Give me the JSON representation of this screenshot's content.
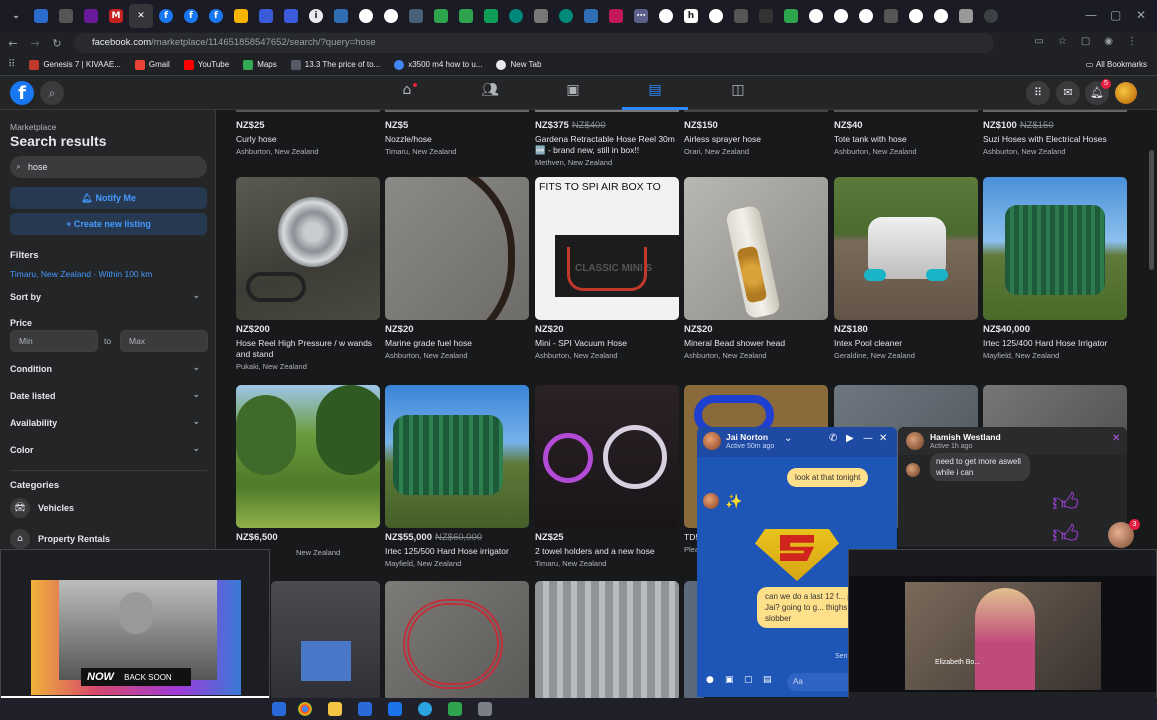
{
  "browser": {
    "url_domain": "facebook.com",
    "url_path": "/marketplace/114651858547652/search/?query=hose",
    "bookmarks": [
      {
        "label": "Genesis 7 | KIVAAE...",
        "color": "#c0392b"
      },
      {
        "label": "Gmail",
        "color": "#ea4335"
      },
      {
        "label": "YouTube",
        "color": "#ff0000"
      },
      {
        "label": "Maps",
        "color": "#34a853"
      },
      {
        "label": "13.3 The price of to...",
        "color": "#555a64"
      },
      {
        "label": "x3500 m4 how to u...",
        "color": "#4285f4"
      },
      {
        "label": "New Tab",
        "color": "#e8eaed"
      }
    ],
    "all_bookmarks": "All Bookmarks"
  },
  "sidebar": {
    "breadcrumb": "Marketplace",
    "title": "Search results",
    "search_value": "hose",
    "notify_button": "Notify Me",
    "create_button": "Create new listing",
    "filters_heading": "Filters",
    "location": "Timaru, New Zealand · Within 100 km",
    "sort_by": "Sort by",
    "price_label": "Price",
    "price_min_placeholder": "Min",
    "price_to": "to",
    "price_max_placeholder": "Max",
    "condition": "Condition",
    "date_listed": "Date listed",
    "availability": "Availability",
    "color": "Color",
    "categories_heading": "Categories",
    "categories": [
      "Vehicles",
      "Property Rentals"
    ]
  },
  "listings_row0": [
    {
      "price": "NZ$25",
      "old_price": "",
      "title": "Curly hose",
      "location": "Ashburton, New Zealand"
    },
    {
      "price": "NZ$5",
      "old_price": "",
      "title": "Nozzle/hose",
      "location": "Timaru, New Zealand"
    },
    {
      "price": "NZ$375",
      "old_price": "NZ$400",
      "title": "Gardena Retractable Hose Reel 30m 🆕 - brand new, still in box!!",
      "location": "Methven, New Zealand"
    },
    {
      "price": "NZ$150",
      "old_price": "",
      "title": "Airless sprayer hose",
      "location": "Orari, New Zealand"
    },
    {
      "price": "NZ$40",
      "old_price": "",
      "title": "Tote tank with hose",
      "location": "Ashburton, New Zealand"
    },
    {
      "price": "NZ$100",
      "old_price": "NZ$150",
      "title": "Suzi Hoses with Electrical Hoses",
      "location": "Ashburton, New Zealand"
    }
  ],
  "listings_row1": [
    {
      "price": "NZ$200",
      "old_price": "",
      "title": "Hose Reel High Pressure / w wands and stand",
      "location": "Pukaki, New Zealand"
    },
    {
      "price": "NZ$20",
      "old_price": "",
      "title": "Marine grade fuel hose",
      "location": "Ashburton, New Zealand"
    },
    {
      "price": "NZ$20",
      "old_price": "",
      "title": "Mini - SPI Vacuum Hose",
      "location": "Ashburton, New Zealand"
    },
    {
      "price": "NZ$20",
      "old_price": "",
      "title": "Mineral Bead shower head",
      "location": "Ashburton, New Zealand"
    },
    {
      "price": "NZ$180",
      "old_price": "",
      "title": "Intex Pool cleaner",
      "location": "Geraldine, New Zealand"
    },
    {
      "price": "NZ$40,000",
      "old_price": "",
      "title": "Irtec 125/400 Hard Hose Irrigator",
      "location": "Mayfield, New Zealand"
    }
  ],
  "listings_row2": [
    {
      "price": "NZ$6,500",
      "old_price": "",
      "title": "",
      "location": "New Zealand"
    },
    {
      "price": "NZ$55,000",
      "old_price": "NZ$60,000",
      "title": "Irtec 125/500 Hard Hose irrigator",
      "location": "Mayfield, New Zealand"
    },
    {
      "price": "NZ$25",
      "old_price": "",
      "title": "2 towel holders and a new hose",
      "location": "Timaru, New Zealand"
    },
    {
      "price": "",
      "old_price": "",
      "title": "TD5",
      "location": "Plea"
    }
  ],
  "thumb_text": {
    "mini_top": "FITS TO SPI AIR BOX TO",
    "mini_mid": "CLASSIC MINI S"
  },
  "chat1": {
    "name": "Jai Norton",
    "status": "Active 50m ago",
    "msg1": "look at that tonight",
    "msg2": "can we do a last 12 f... please Jai? going to g... thighs to slobber",
    "sent": "Sent",
    "input_placeholder": "Aa"
  },
  "chat2": {
    "name": "Hamish Westland",
    "status": "Active 1h ago",
    "msg": "need to get more aswell while i can"
  },
  "pip1": {
    "overlay": "BACK SOON",
    "brand": "NOW"
  },
  "pip2": {
    "name": "Elizabeth Bo..."
  },
  "badges": {
    "notifications": "5",
    "messenger_bubble": "3"
  },
  "colors": {
    "accent": "#2d88ff",
    "fb_blue": "#1877f2",
    "chat_blue": "#1e56b8"
  }
}
